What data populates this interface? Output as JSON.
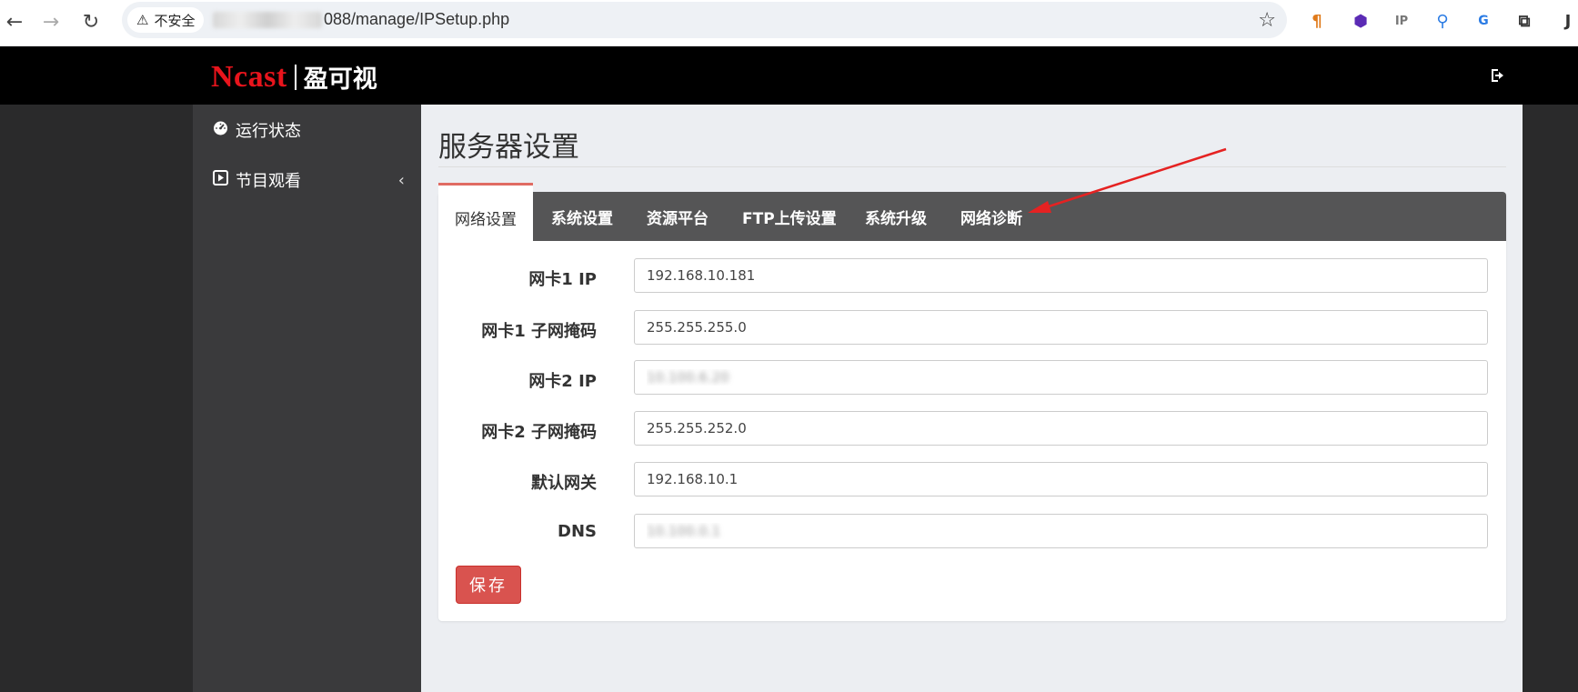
{
  "browser": {
    "security_label": "不安全",
    "url_suffix": "088/manage/IPSetup.php",
    "star": "☆"
  },
  "header": {
    "brand": "Ncast",
    "brand_cn": "盈可视"
  },
  "sidebar": {
    "items": [
      {
        "label": "运行状态",
        "icon": "dashboard-icon"
      },
      {
        "label": "节目观看",
        "icon": "play-icon",
        "chevron": "‹"
      }
    ]
  },
  "main": {
    "title": "服务器设置",
    "tabs": [
      {
        "label": "网络设置",
        "active": true
      },
      {
        "label": "系统设置"
      },
      {
        "label": "资源平台"
      },
      {
        "label": "FTP上传设置"
      },
      {
        "label": "系统升级"
      },
      {
        "label": "网络诊断"
      }
    ],
    "fields": [
      {
        "label": "网卡1 IP",
        "value": "192.168.10.181"
      },
      {
        "label": "网卡1 子网掩码",
        "value": "255.255.255.0"
      },
      {
        "label": "网卡2 IP",
        "value": "10.100.6.20"
      },
      {
        "label": "网卡2 子网掩码",
        "value": "255.255.252.0"
      },
      {
        "label": "默认网关",
        "value": "192.168.10.1"
      },
      {
        "label": "DNS",
        "value": "10.100.0.1"
      }
    ],
    "save_label": "保存"
  },
  "colors": {
    "brand_red": "#e8141c",
    "save_red": "#d9534f",
    "tab_strip": "#555556",
    "arrow_red": "#e52222"
  }
}
